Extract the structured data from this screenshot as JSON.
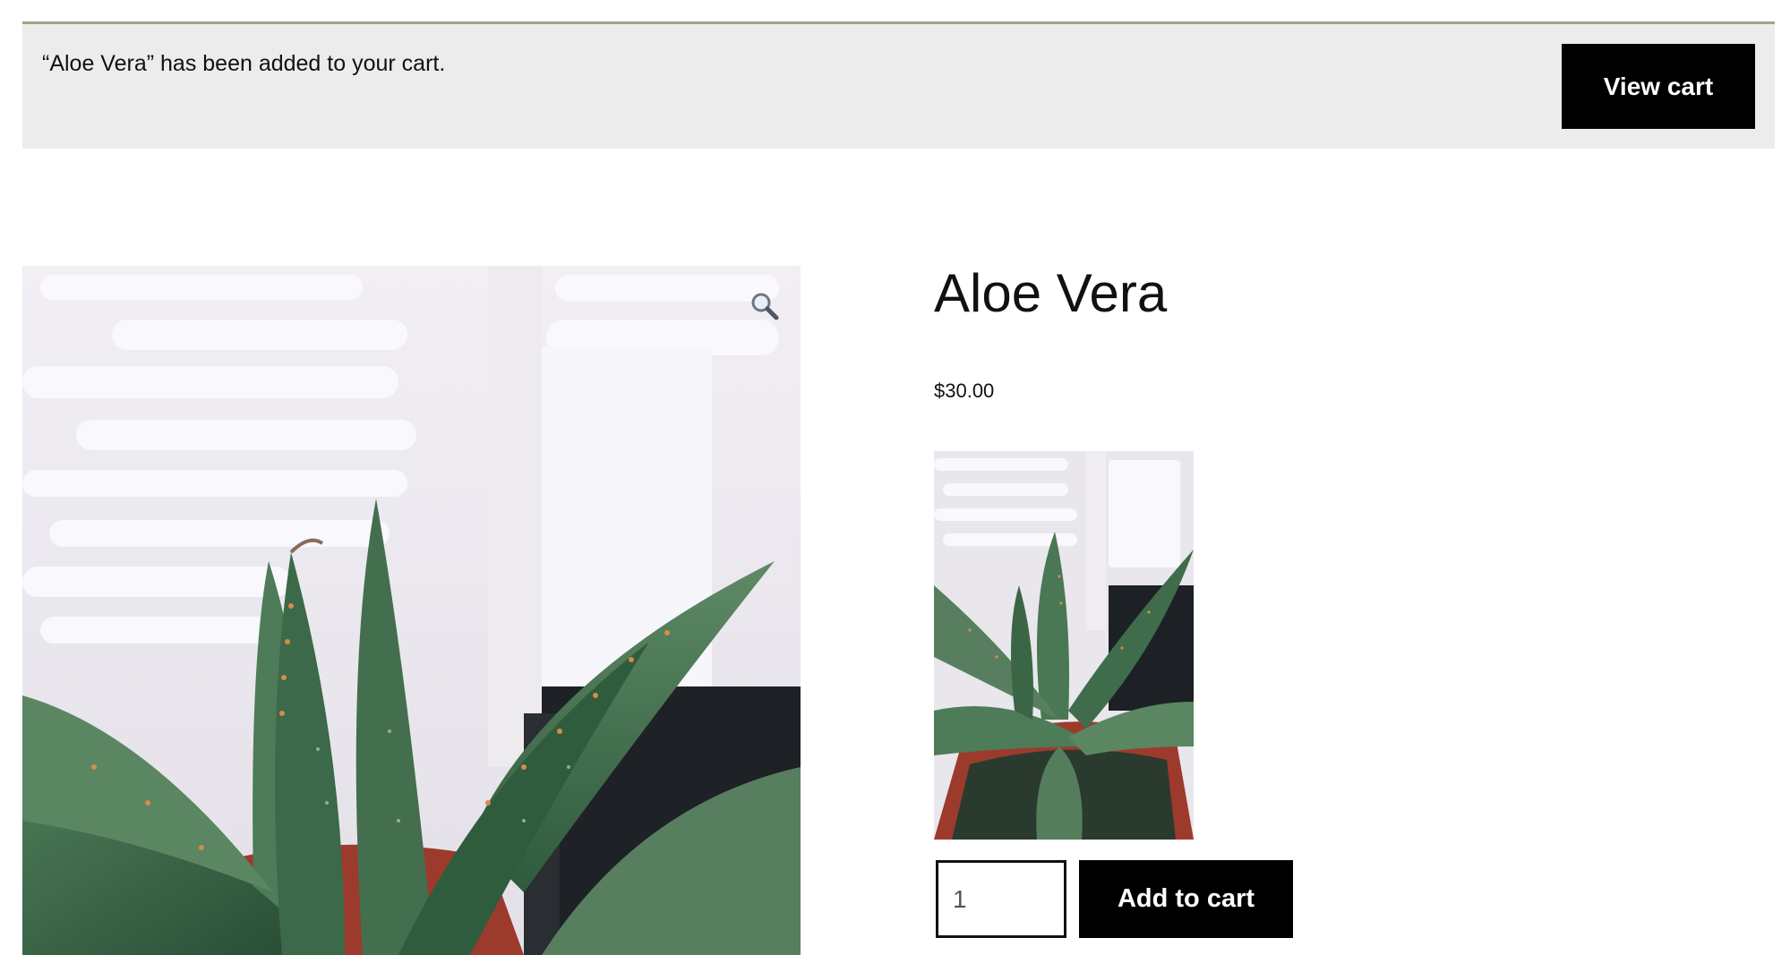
{
  "notice": {
    "message": "“Aloe Vera” has been added to your cart.",
    "view_cart_label": "View cart",
    "accent_color": "#9aa885",
    "background_color": "#ececec"
  },
  "product": {
    "title": "Aloe Vera",
    "price": "$30.00",
    "main_image_icon": "aloe-vera-plant-photo",
    "zoom_icon": "magnifier-zoom-icon",
    "thumbnail_icon": "aloe-vera-plant-thumbnail"
  },
  "purchase": {
    "quantity": "1",
    "add_to_cart_label": "Add to cart"
  },
  "colors": {
    "button_background": "#000000",
    "button_text": "#ffffff",
    "leaf_green": "#3e6b4a"
  }
}
